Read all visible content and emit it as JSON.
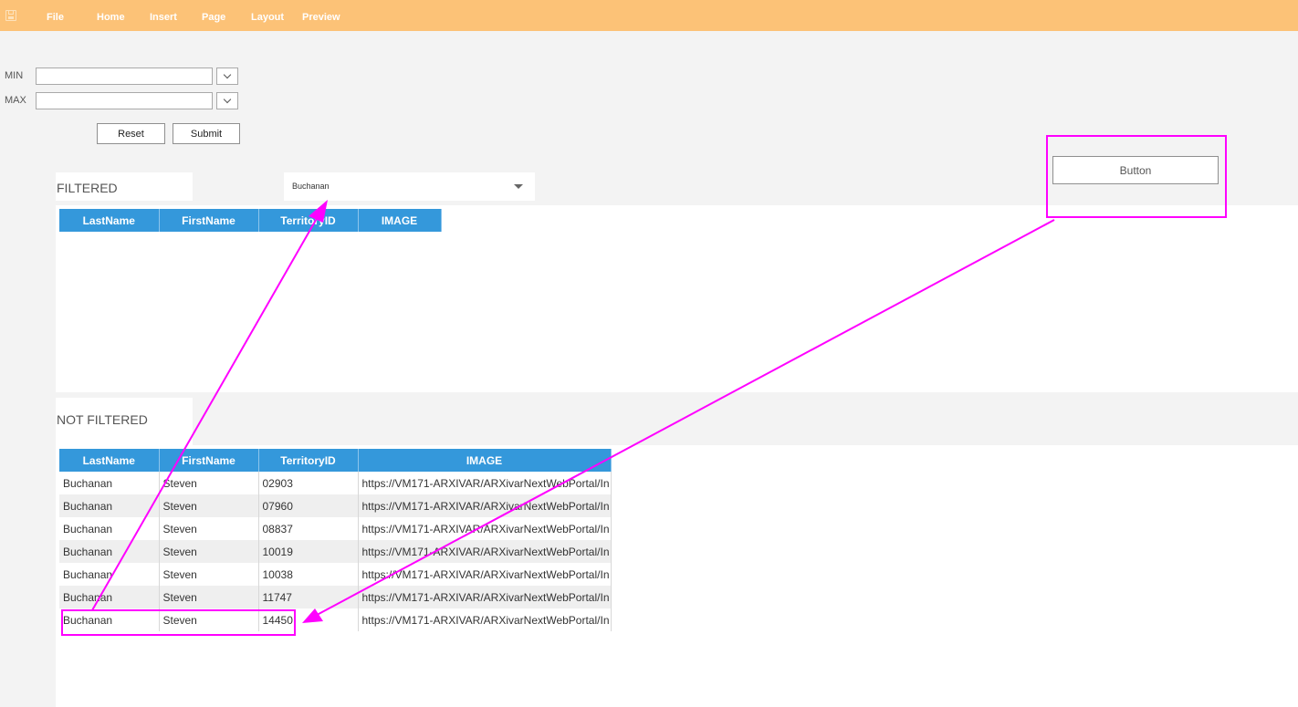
{
  "menu": {
    "items": [
      {
        "label": "File"
      },
      {
        "label": "Home"
      },
      {
        "label": "Insert"
      },
      {
        "label": "Page"
      },
      {
        "label": "Layout"
      },
      {
        "label": "Preview"
      }
    ]
  },
  "filters": {
    "min_label": "MIN",
    "max_label": "MAX",
    "min_value": "",
    "max_value": "",
    "reset_label": "Reset",
    "submit_label": "Submit"
  },
  "generic_button": {
    "label": "Button"
  },
  "filtered": {
    "title": "FILTERED",
    "dropdown_value": "Buchanan",
    "columns": [
      "LastName",
      "FirstName",
      "TerritoryID",
      "IMAGE"
    ]
  },
  "not_filtered": {
    "title": "NOT FILTERED",
    "columns": [
      "LastName",
      "FirstName",
      "TerritoryID",
      "IMAGE"
    ],
    "rows": [
      [
        "Buchanan",
        "Steven",
        "02903",
        "https://VM171-ARXIVAR/ARXivarNextWebPortal/In"
      ],
      [
        "Buchanan",
        "Steven",
        "07960",
        "https://VM171-ARXIVAR/ARXivarNextWebPortal/In"
      ],
      [
        "Buchanan",
        "Steven",
        "08837",
        "https://VM171-ARXIVAR/ARXivarNextWebPortal/In"
      ],
      [
        "Buchanan",
        "Steven",
        "10019",
        "https://VM171-ARXIVAR/ARXivarNextWebPortal/In"
      ],
      [
        "Buchanan",
        "Steven",
        "10038",
        "https://VM171-ARXIVAR/ARXivarNextWebPortal/In"
      ],
      [
        "Buchanan",
        "Steven",
        "11747",
        "https://VM171-ARXIVAR/ARXivarNextWebPortal/In"
      ],
      [
        "Buchanan",
        "Steven",
        "14450",
        "https://VM171-ARXIVAR/ARXivarNextWebPortal/In"
      ]
    ]
  },
  "colors": {
    "toolbar_bg": "#fcc277",
    "grid_header": "#3498db",
    "annotation": "#ff00ff"
  },
  "icons": {
    "save": "save-icon",
    "dropdown": "chevron-down-icon",
    "select_caret": "caret-down-icon"
  }
}
